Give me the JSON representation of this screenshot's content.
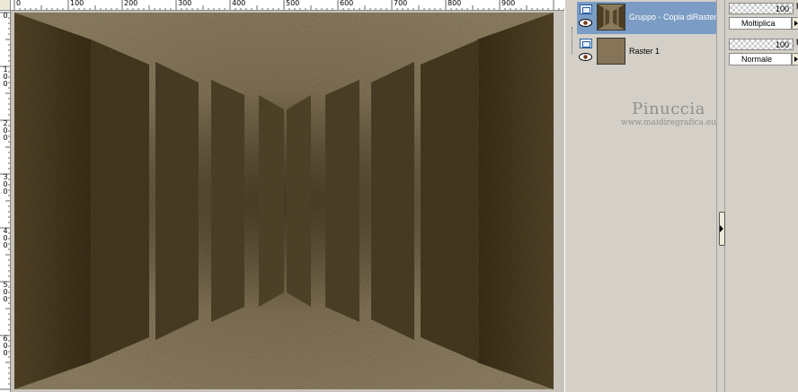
{
  "ruler": {
    "top_labels": [
      "0",
      "100",
      "200",
      "300",
      "400",
      "500",
      "600",
      "700",
      "800",
      "900"
    ],
    "left_labels": [
      "0",
      "100",
      "200",
      "300",
      "400",
      "500",
      "600"
    ]
  },
  "canvas": {
    "image_colors": {
      "floor": "#8a7a5c",
      "wall_dark": "#4a3d22",
      "panel": "#6b5b3a"
    }
  },
  "layers": {
    "items": [
      {
        "name": "Gruppo - Copia diRaster",
        "selected": true,
        "visible": true,
        "icon": "eye-icon"
      },
      {
        "name": "Raster 1",
        "selected": false,
        "visible": true,
        "icon": "eye-icon"
      }
    ]
  },
  "properties": [
    {
      "opacity": "100",
      "blend_mode": "Moltiplica"
    },
    {
      "opacity": "100",
      "blend_mode": "Normale"
    }
  ],
  "watermark": {
    "name": "Pinuccia",
    "url": "www.maidiregrafica.eu"
  },
  "colors": {
    "selection": "#7b9cc4",
    "panel_bg": "#d4d0c8"
  }
}
